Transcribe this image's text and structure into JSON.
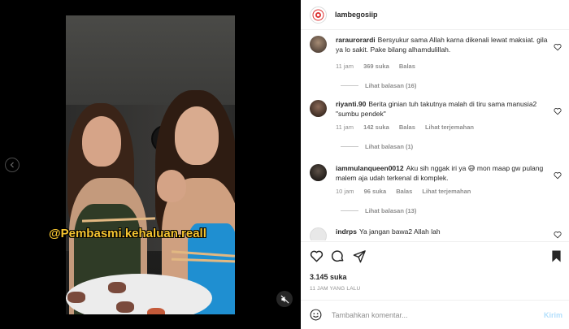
{
  "media": {
    "watermark_text": "@Pembasmi.kehaluan.reall",
    "mute_icon": "speaker-muted-icon",
    "prev_icon": "chevron-left-icon"
  },
  "post": {
    "username": "lambegosiip",
    "likes": "3.145 suka",
    "time_ago": "11 JAM YANG LALU"
  },
  "comments": [
    {
      "username": "raraurorardi",
      "text": "Bersyukur sama Allah karna dikenali lewat maksiat. gila ya lo sakit. Pake bilang alhamdulillah.",
      "time": "11 jam",
      "likes": "369 suka",
      "reply": "Balas",
      "translate": "",
      "view_replies": "Lihat balasan (16)"
    },
    {
      "username": "riyanti.90",
      "text": "Berita ginian tuh takutnya malah di tiru sama manusia2 \"sumbu pendek\"",
      "time": "11 jam",
      "likes": "142 suka",
      "reply": "Balas",
      "translate": "Lihat terjemahan",
      "view_replies": "Lihat balasan (1)"
    },
    {
      "username": "iammulanqueen0012",
      "text": "Aku sih nggak iri ya 😅 mon maap gw pulang malem aja udah terkenal di komplek.",
      "time": "10 jam",
      "likes": "96 suka",
      "reply": "Balas",
      "translate": "Lihat terjemahan",
      "view_replies": "Lihat balasan (13)"
    },
    {
      "username": "indrps",
      "text": "Ya jangan bawa2 Allah lah",
      "time": "",
      "likes": "",
      "reply": "",
      "translate": "",
      "view_replies": ""
    }
  ],
  "compose": {
    "placeholder": "Tambahkan komentar...",
    "post_label": "Kirim"
  },
  "colors": {
    "link_disabled": "#b2dffc",
    "secondary_text": "#8e8e8e",
    "watermark": "#f5c430"
  }
}
